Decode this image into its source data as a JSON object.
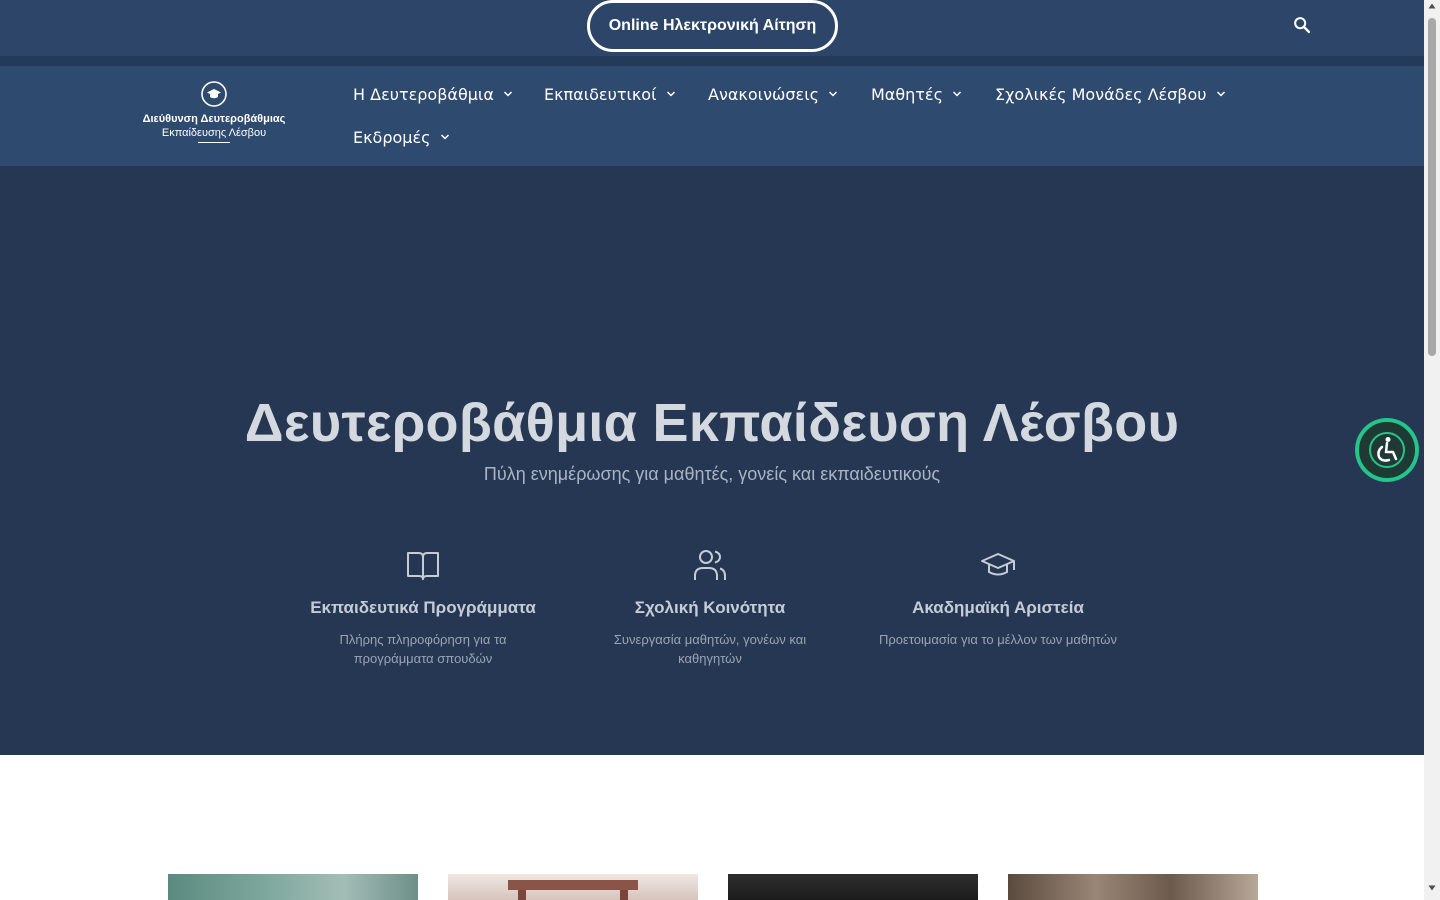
{
  "topbar": {
    "apply_button": "Online Ηλεκτρονική Αίτηση",
    "search_icon": "search-icon"
  },
  "logo": {
    "line1": "Διεύθυνση Δευτεροβάθμιας",
    "line2": "Εκπαίδευσης Λέσβου",
    "emblem_icon": "graduation-cap-icon"
  },
  "nav": {
    "items": [
      {
        "label": "Η Δευτεροβάθμια",
        "icon": "chevron-down-icon"
      },
      {
        "label": "Εκπαιδευτικοί",
        "icon": "chevron-down-icon"
      },
      {
        "label": "Ανακοινώσεις",
        "icon": "chevron-down-icon"
      },
      {
        "label": "Μαθητές",
        "icon": "chevron-down-icon"
      },
      {
        "label": "Σχολικές Μονάδες Λέσβου",
        "icon": "chevron-down-icon"
      },
      {
        "label": "Εκδρομές",
        "icon": "chevron-down-icon"
      }
    ]
  },
  "hero": {
    "title": "Δευτεροβάθμια Εκπαίδευση Λέσβου",
    "subtitle": "Πύλη ενημέρωσης για μαθητές, γονείς και εκπαιδευτικούς",
    "features": [
      {
        "icon": "book-open-icon",
        "title": "Εκπαιδευτικά Προγράμματα",
        "desc": "Πλήρης πληροφόρηση για τα προγράμματα σπουδών"
      },
      {
        "icon": "users-icon",
        "title": "Σχολική Κοινότητα",
        "desc": "Συνεργασία μαθητών, γονέων και καθηγητών"
      },
      {
        "icon": "graduation-cap-icon",
        "title": "Ακαδημαϊκή Αριστεία",
        "desc": "Προετοιμασία για το μέλλον των μαθητών"
      }
    ]
  },
  "accessibility": {
    "icon": "accessibility-icon"
  },
  "colors": {
    "topbar": "#2c4568",
    "navbar": "#2e4a6e",
    "hero": "#263753",
    "accessibility_ring": "#24c48a"
  }
}
